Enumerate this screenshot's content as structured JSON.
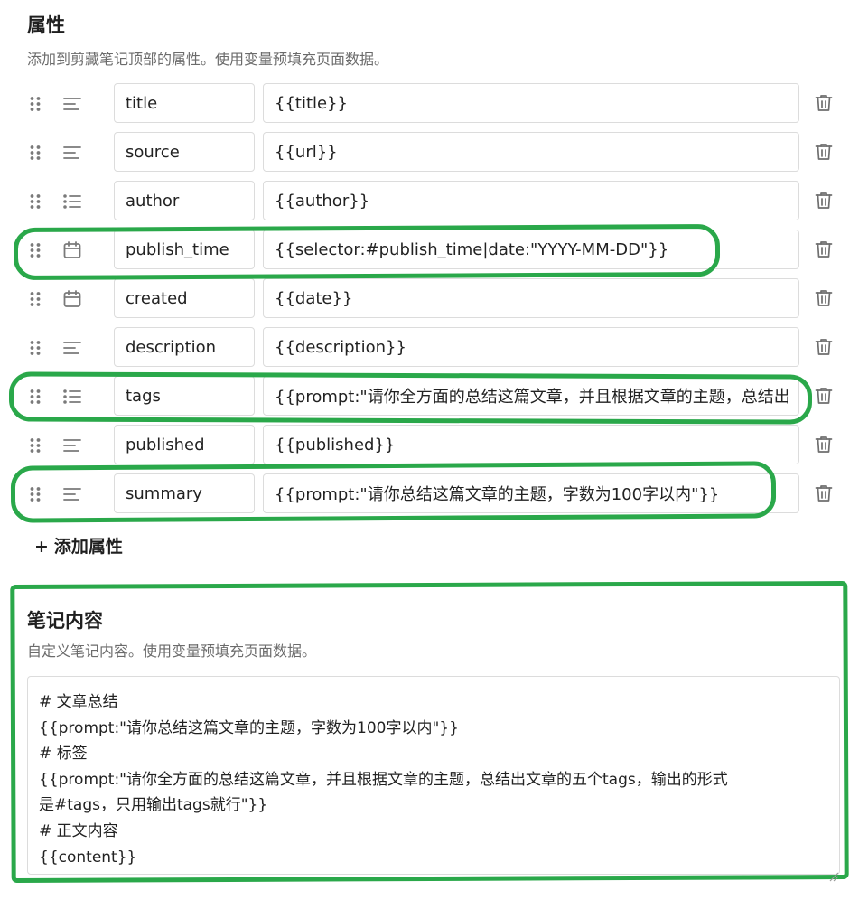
{
  "properties_section": {
    "title": "属性",
    "description": "添加到剪藏笔记顶部的属性。使用变量预填充页面数据。"
  },
  "properties": [
    {
      "type_icon": "text-lines-icon",
      "name": "title",
      "value": "{{title}}"
    },
    {
      "type_icon": "text-lines-icon",
      "name": "source",
      "value": "{{url}}"
    },
    {
      "type_icon": "bullet-list-icon",
      "name": "author",
      "value": "{{author}}"
    },
    {
      "type_icon": "calendar-icon",
      "name": "publish_time",
      "value": "{{selector:#publish_time|date:\"YYYY-MM-DD\"}}"
    },
    {
      "type_icon": "calendar-icon",
      "name": "created",
      "value": "{{date}}"
    },
    {
      "type_icon": "text-lines-icon",
      "name": "description",
      "value": "{{description}}"
    },
    {
      "type_icon": "bullet-list-icon",
      "name": "tags",
      "value": "{{prompt:\"请你全方面的总结这篇文章，并且根据文章的主题，总结出文章的五个tags，输出的形式是#tags，只用输出tags就行\"}}"
    },
    {
      "type_icon": "text-lines-icon",
      "name": "published",
      "value": "{{published}}"
    },
    {
      "type_icon": "text-lines-icon",
      "name": "summary",
      "value": "{{prompt:\"请你总结这篇文章的主题，字数为100字以内\"}}"
    }
  ],
  "add_property_label": "添加属性",
  "note_content_section": {
    "title": "笔记内容",
    "description": "自定义笔记内容。使用变量预填充页面数据。",
    "lines": [
      "# 文章总结",
      "{{prompt:\"请你总结这篇文章的主题，字数为100字以内\"}}",
      "# 标签",
      "{{prompt:\"请你全方面的总结这篇文章，并且根据文章的主题，总结出文章的五个tags，输出的形式",
      "是#tags，只用输出tags就行\"}}",
      "# 正文内容",
      "{{content}}"
    ]
  },
  "colors": {
    "highlight": "#2aa84a",
    "icon": "#7a7a7a",
    "border": "#dcdcdc"
  }
}
